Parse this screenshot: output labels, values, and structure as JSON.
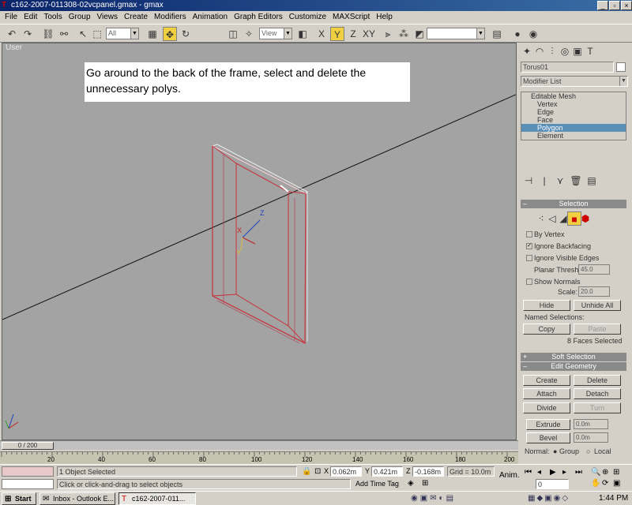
{
  "window": {
    "title": "c162-2007-011308-02vcpanel.gmax - gmax"
  },
  "menu": [
    "File",
    "Edit",
    "Tools",
    "Group",
    "Views",
    "Create",
    "Modifiers",
    "Animation",
    "Graph Editors",
    "Customize",
    "MAXScript",
    "Help"
  ],
  "toolbar": {
    "selection_filter": "All",
    "ref_coord": "View"
  },
  "viewport": {
    "label": "User",
    "note": "Go around to the back of the frame, select and delete the unnecessary polys."
  },
  "command_panel": {
    "object_name": "Torus01",
    "modifier_list": "Modifier List",
    "stack": [
      "Editable Mesh",
      "Vertex",
      "Edge",
      "Face",
      "Polygon",
      "Element"
    ],
    "selected_level": "Polygon",
    "selection": {
      "header": "Selection",
      "by_vertex": "By Vertex",
      "ignore_backfacing": "Ignore Backfacing",
      "ignore_visible_edges": "Ignore Visible Edges",
      "planar_thresh_label": "Planar Thresh:",
      "planar_thresh_value": "45.0",
      "show_normals": "Show Normals",
      "scale_label": "Scale:",
      "scale_value": "20.0",
      "hide": "Hide",
      "unhide_all": "Unhide All",
      "named_selections": "Named Selections:",
      "copy": "Copy",
      "paste": "Paste",
      "status": "8 Faces Selected"
    },
    "soft_selection": "Soft Selection",
    "edit_geometry": {
      "header": "Edit Geometry",
      "create": "Create",
      "delete": "Delete",
      "attach": "Attach",
      "detach": "Detach",
      "divide": "Divide",
      "turn": "Turn",
      "extrude": "Extrude",
      "extrude_value": "0.0m",
      "bevel": "Bevel",
      "bevel_value": "0.0m",
      "normal_label": "Normal:",
      "group": "Group",
      "local": "Local"
    }
  },
  "timeline": {
    "slider": "0 / 200",
    "ticks": [
      "20",
      "40",
      "60",
      "80",
      "100",
      "120",
      "140",
      "160",
      "180",
      "200"
    ]
  },
  "status": {
    "objects": "1 Object Selected",
    "prompt": "Click or click-and-drag to select objects",
    "x_label": "X",
    "x": "0.062m",
    "y_label": "Y",
    "y": "0.421m",
    "z_label": "Z",
    "z": "-0.168m",
    "grid": "Grid = 10.0m",
    "add_time_tag": "Add Time Tag",
    "anim": "Anim.",
    "frame": "0"
  },
  "taskbar": {
    "start": "Start",
    "tasks": [
      "Inbox - Outlook E...",
      "c162-2007-011..."
    ],
    "clock": "1:44 PM"
  },
  "colors": {
    "viewport_bg": "#a3a3a3",
    "selection_red": "#c8303a",
    "title_blue": "#0a246a",
    "highlight": "#5a8fb8"
  }
}
